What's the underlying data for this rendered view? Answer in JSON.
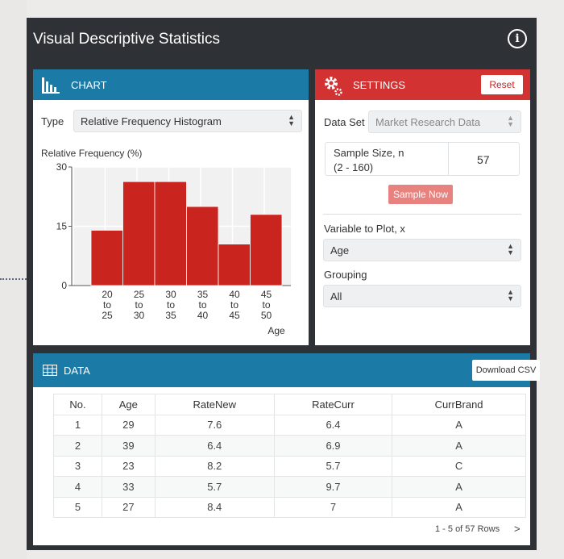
{
  "app": {
    "title": "Visual Descriptive Statistics",
    "info_glyph": "i"
  },
  "chart_panel": {
    "header": "CHART",
    "type_label": "Type",
    "type_value": "Relative Frequency Histogram"
  },
  "settings_panel": {
    "header": "SETTINGS",
    "reset_label": "Reset",
    "dataset_label": "Data Set",
    "dataset_value": "Market Research Data",
    "sample_size_label_1": "Sample Size, n",
    "sample_size_label_2": "(2 - 160)",
    "sample_size_value": "57",
    "sample_now_label": "Sample Now",
    "variable_label": "Variable to Plot, x",
    "variable_value": "Age",
    "grouping_label": "Grouping",
    "grouping_value": "All"
  },
  "data_panel": {
    "header": "DATA",
    "download_label": "Download CSV",
    "columns": [
      "No.",
      "Age",
      "RateNew",
      "RateCurr",
      "CurrBrand"
    ],
    "rows": [
      [
        "1",
        "29",
        "7.6",
        "6.4",
        "A"
      ],
      [
        "2",
        "39",
        "6.4",
        "6.9",
        "A"
      ],
      [
        "3",
        "23",
        "8.2",
        "5.7",
        "C"
      ],
      [
        "4",
        "33",
        "5.7",
        "9.7",
        "A"
      ],
      [
        "5",
        "27",
        "8.4",
        "7",
        "A"
      ]
    ],
    "pager_text": "1 - 5 of 57 Rows",
    "next_glyph": ">"
  },
  "chart_data": {
    "type": "bar",
    "ylabel": "Relative Frequency (%)",
    "xlabel": "Age",
    "ylim": [
      0,
      30
    ],
    "yticks": [
      "0",
      "15",
      "30"
    ],
    "categories": [
      [
        "20",
        "to",
        "25"
      ],
      [
        "25",
        "to",
        "30"
      ],
      [
        "30",
        "to",
        "35"
      ],
      [
        "35",
        "to",
        "40"
      ],
      [
        "40",
        "to",
        "45"
      ],
      [
        "45",
        "to",
        "50"
      ]
    ],
    "values": [
      14,
      26.3,
      26.3,
      20,
      10.5,
      18
    ],
    "bar_color": "#c9241e",
    "grid": true
  },
  "colors": {
    "blue_header": "#1b7aa6",
    "red_header": "#d23232",
    "dark_bg": "#2e3236"
  }
}
